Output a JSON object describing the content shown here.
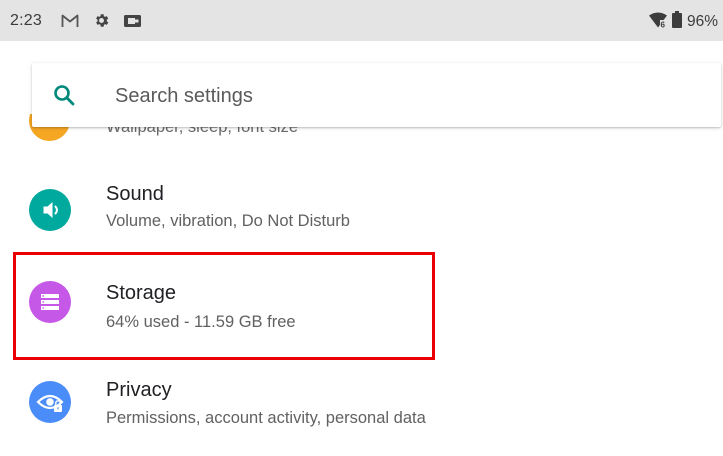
{
  "status_bar": {
    "time": "2:23",
    "left_icons": [
      "gmail-icon",
      "gear-icon",
      "screen-record-icon"
    ],
    "battery_percent": "96%",
    "right_icons": [
      "wifi-icon",
      "battery-icon"
    ]
  },
  "search": {
    "placeholder": "Search settings",
    "icon": "search-icon",
    "accent_color": "#00897b"
  },
  "settings": {
    "display_subtitle_partial": "Wallpaper, sleep, font size",
    "items": [
      {
        "title": "Sound",
        "subtitle": "Volume, vibration, Do Not Disturb",
        "icon": "volume-icon",
        "color": "#00a99d"
      },
      {
        "title": "Storage",
        "subtitle": "64% used - 11.59 GB free",
        "icon": "storage-icon",
        "color": "#c658e8"
      },
      {
        "title": "Privacy",
        "subtitle": "Permissions, account activity, personal data",
        "icon": "privacy-icon",
        "color": "#4a8df8"
      }
    ]
  },
  "highlight": {
    "target": "Storage",
    "color": "#ea0000"
  }
}
